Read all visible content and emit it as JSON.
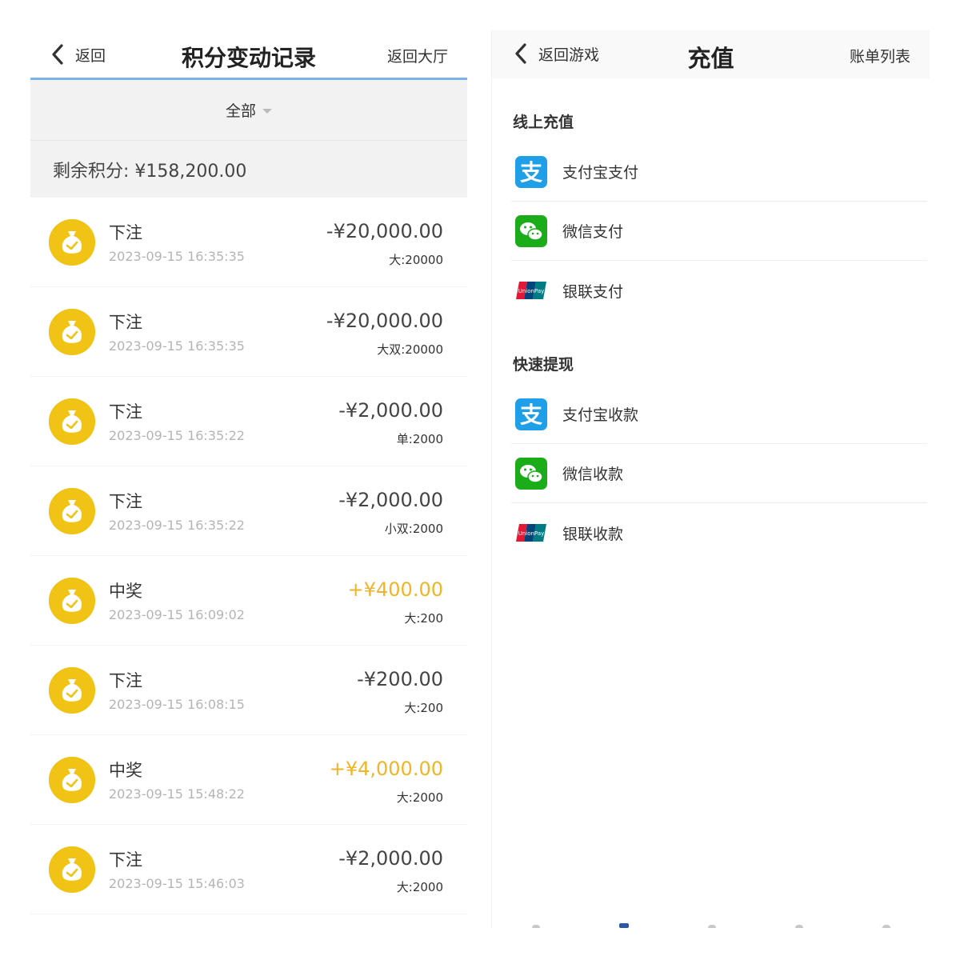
{
  "left": {
    "back_label": "返回",
    "title": "积分变动记录",
    "right_label": "返回大厅",
    "filter_label": "全部",
    "balance_text": "剩余积分: ¥158,200.00",
    "records": [
      {
        "type": "下注",
        "time": "2023-09-15 16:35:35",
        "amount": "-¥20,000.00",
        "detail": "大:20000"
      },
      {
        "type": "下注",
        "time": "2023-09-15 16:35:35",
        "amount": "-¥20,000.00",
        "detail": "大双:20000"
      },
      {
        "type": "下注",
        "time": "2023-09-15 16:35:22",
        "amount": "-¥2,000.00",
        "detail": "单:2000"
      },
      {
        "type": "下注",
        "time": "2023-09-15 16:35:22",
        "amount": "-¥2,000.00",
        "detail": "小双:2000"
      },
      {
        "type": "中奖",
        "time": "2023-09-15 16:09:02",
        "amount": "+¥400.00",
        "detail": "大:200"
      },
      {
        "type": "下注",
        "time": "2023-09-15 16:08:15",
        "amount": "-¥200.00",
        "detail": "大:200"
      },
      {
        "type": "中奖",
        "time": "2023-09-15 15:48:22",
        "amount": "+¥4,000.00",
        "detail": "大:2000"
      },
      {
        "type": "下注",
        "time": "2023-09-15 15:46:03",
        "amount": "-¥2,000.00",
        "detail": "大:2000"
      }
    ]
  },
  "right": {
    "back_label": "返回游戏",
    "title": "充值",
    "right_label": "账单列表",
    "online_title": "线上充值",
    "online": [
      {
        "label": "支付宝支付",
        "icon": "alipay-icon"
      },
      {
        "label": "微信支付",
        "icon": "wechat-icon"
      },
      {
        "label": "银联支付",
        "icon": "unionpay-icon"
      }
    ],
    "withdraw_title": "快速提现",
    "withdraw": [
      {
        "label": "支付宝收款",
        "icon": "alipay-icon"
      },
      {
        "label": "微信收款",
        "icon": "wechat-icon"
      },
      {
        "label": "银联收款",
        "icon": "unionpay-icon"
      }
    ]
  },
  "colors": {
    "accent_line": "#7ab3ea",
    "coin": "#f0c314",
    "win_amount": "#f0b428",
    "alipay": "#1e9fe8",
    "wechat": "#1aad19"
  }
}
